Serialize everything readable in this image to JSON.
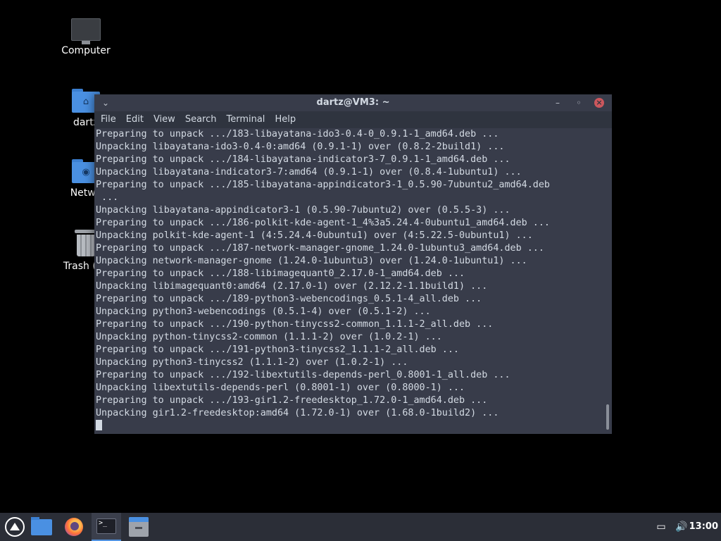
{
  "desktop": {
    "icons": [
      {
        "label": "Computer",
        "icon": "computer-icon"
      },
      {
        "label": "dartz",
        "icon": "home-folder-icon"
      },
      {
        "label": "Netwo",
        "icon": "network-folder-icon"
      },
      {
        "label": "Trash (4 i",
        "icon": "trash-icon"
      }
    ]
  },
  "window": {
    "title": "dartz@VM3: ~",
    "menu": [
      "File",
      "Edit",
      "View",
      "Search",
      "Terminal",
      "Help"
    ],
    "lines": [
      "Preparing to unpack .../183-libayatana-ido3-0.4-0_0.9.1-1_amd64.deb ...",
      "Unpacking libayatana-ido3-0.4-0:amd64 (0.9.1-1) over (0.8.2-2build1) ...",
      "Preparing to unpack .../184-libayatana-indicator3-7_0.9.1-1_amd64.deb ...",
      "Unpacking libayatana-indicator3-7:amd64 (0.9.1-1) over (0.8.4-1ubuntu1) ...",
      "Preparing to unpack .../185-libayatana-appindicator3-1_0.5.90-7ubuntu2_amd64.deb",
      " ...",
      "Unpacking libayatana-appindicator3-1 (0.5.90-7ubuntu2) over (0.5.5-3) ...",
      "Preparing to unpack .../186-polkit-kde-agent-1_4%3a5.24.4-0ubuntu1_amd64.deb ...",
      "Unpacking polkit-kde-agent-1 (4:5.24.4-0ubuntu1) over (4:5.22.5-0ubuntu1) ...",
      "Preparing to unpack .../187-network-manager-gnome_1.24.0-1ubuntu3_amd64.deb ...",
      "Unpacking network-manager-gnome (1.24.0-1ubuntu3) over (1.24.0-1ubuntu1) ...",
      "Preparing to unpack .../188-libimagequant0_2.17.0-1_amd64.deb ...",
      "Unpacking libimagequant0:amd64 (2.17.0-1) over (2.12.2-1.1build1) ...",
      "Preparing to unpack .../189-python3-webencodings_0.5.1-4_all.deb ...",
      "Unpacking python3-webencodings (0.5.1-4) over (0.5.1-2) ...",
      "Preparing to unpack .../190-python-tinycss2-common_1.1.1-2_all.deb ...",
      "Unpacking python-tinycss2-common (1.1.1-2) over (1.0.2-1) ...",
      "Preparing to unpack .../191-python3-tinycss2_1.1.1-2_all.deb ...",
      "Unpacking python3-tinycss2 (1.1.1-2) over (1.0.2-1) ...",
      "Preparing to unpack .../192-libextutils-depends-perl_0.8001-1_all.deb ...",
      "Unpacking libextutils-depends-perl (0.8001-1) over (0.8000-1) ...",
      "Preparing to unpack .../193-gir1.2-freedesktop_1.72.0-1_amd64.deb ...",
      "Unpacking gir1.2-freedesktop:amd64 (1.72.0-1) over (1.68.0-1build2) ..."
    ]
  },
  "taskbar": {
    "apps": [
      "start-menu-icon",
      "file-manager-icon",
      "firefox-icon",
      "terminal-icon",
      "archive-icon"
    ],
    "clock": "13:00"
  },
  "colors": {
    "title_bg": "#383c4a",
    "terminal_bg": "#383c4a",
    "close_red": "#cc575d",
    "accent": "#5294e2"
  }
}
